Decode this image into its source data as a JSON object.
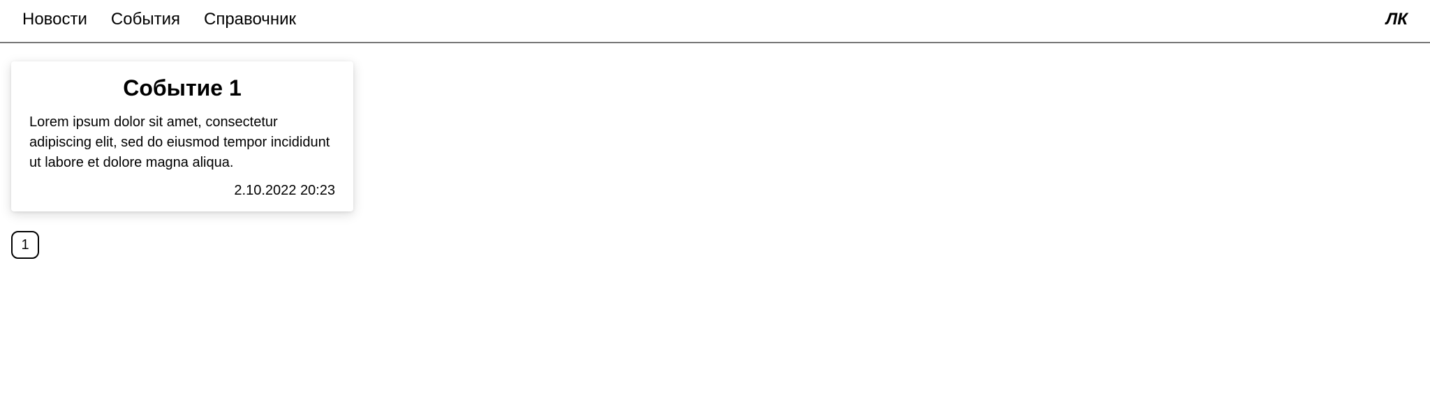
{
  "nav": {
    "items": [
      {
        "label": "Новости"
      },
      {
        "label": "События"
      },
      {
        "label": "Справочник"
      }
    ],
    "account": "ЛК"
  },
  "cards": [
    {
      "title": "Событие 1",
      "body": "Lorem ipsum dolor sit amet, consectetur adipiscing elit, sed do eiusmod tempor incididunt ut labore et dolore magna aliqua.",
      "date": "2.10.2022 20:23"
    }
  ],
  "pagination": {
    "pages": [
      {
        "label": "1"
      }
    ]
  }
}
